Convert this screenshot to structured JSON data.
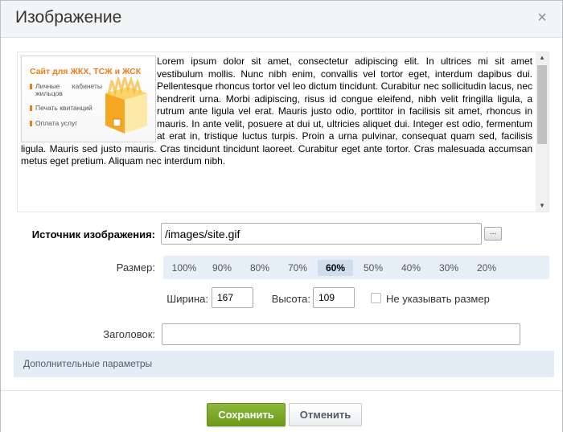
{
  "dialog": {
    "title": "Изображение"
  },
  "preview": {
    "banner": {
      "heading": "Сайт для ЖКХ, ТСЖ и ЖСК",
      "items": [
        "Личные кабинеты жильцов",
        "Печать квитанций",
        "Оплата услуг"
      ]
    },
    "text": "Lorem ipsum dolor sit amet, consectetur adipiscing elit. In ultrices mi sit amet vestibulum mollis. Nunc nibh enim, convallis vel tortor eget, interdum dapibus dui. Pellentesque rhoncus tortor vel leo dictum tincidunt. Curabitur nec sollicitudin lacus, nec hendrerit urna. Morbi adipiscing, risus id congue eleifend, nibh velit fringilla ligula, a rutrum ante ligula vel erat. Mauris justo odio, porttitor in facilisis sit amet, rhoncus in mauris. In ante velit, posuere at dui ut, ultricies aliquet dui. Integer est odio, fermentum at erat in, tristique luctus turpis. Proin a urna pulvinar, consequat quam sed, facilisis ligula. Mauris sed justo mauris. Cras tincidunt tincidunt laoreet. Curabitur eget ante tortor. Cras malesuada accumsan metus eget pretium. Aliquam nec interdum nibh."
  },
  "form": {
    "source_label": "Источник изображения:",
    "source_value": "/images/site.gif",
    "browse_label": "...",
    "size_label": "Размер:",
    "size_options": [
      "100%",
      "90%",
      "80%",
      "70%",
      "60%",
      "50%",
      "40%",
      "30%",
      "20%"
    ],
    "size_selected": "60%",
    "width_label": "Ширина:",
    "width_value": "167",
    "height_label": "Высота:",
    "height_value": "109",
    "no_size_label": "Не указывать размер",
    "caption_label": "Заголовок:",
    "caption_value": "",
    "advanced_label": "Дополнительные параметры"
  },
  "footer": {
    "save_label": "Сохранить",
    "cancel_label": "Отменить"
  },
  "colors": {
    "accent_green": "#7cab28",
    "orange": "#ef7d17",
    "size_bar": "#e6eef7"
  }
}
